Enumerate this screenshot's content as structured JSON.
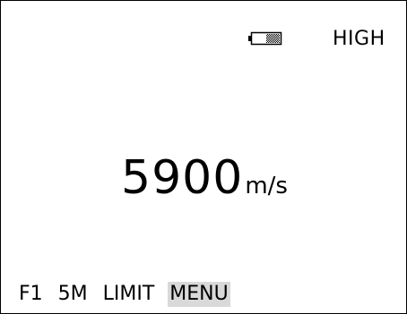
{
  "status": {
    "battery_icon": "battery-icon",
    "mode": "HIGH"
  },
  "reading": {
    "value": "5900",
    "unit": "m/s"
  },
  "softkeys": [
    {
      "label": "F1"
    },
    {
      "label": "5M"
    },
    {
      "label": "LIMIT"
    },
    {
      "label": "MENU",
      "highlighted": true
    }
  ],
  "colors": {
    "background": "#ffffff",
    "foreground": "#000000",
    "highlight": "#d9d9d9"
  }
}
